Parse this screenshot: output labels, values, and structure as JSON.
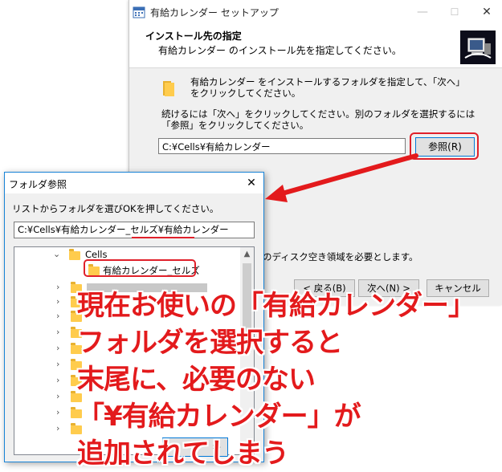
{
  "setup_window": {
    "title": "有給カレンダー セットアップ",
    "header_title": "インストール先の指定",
    "header_subtitle": "有給カレンダー のインストール先を指定してください。",
    "instruction1": "有給カレンダー をインストールするフォルダを指定して、「次へ」をクリックしてください。",
    "instruction2": "続けるには「次へ」をクリックしてください。別のフォルダを選択するには「参照」をクリックしてください。",
    "install_path": "C:¥Cells¥有給カレンダー",
    "browse_button": "参照(R)",
    "disk_space_text": "のディスク空き領域を必要とします。",
    "back_button": "< 戻る(B)",
    "next_button": "次へ(N) >",
    "cancel_button": "キャンセル",
    "minimize_glyph": "—",
    "maximize_glyph": "☐",
    "close_glyph": "✕"
  },
  "browse_dialog": {
    "title": "フォルダ参照",
    "instruction": "リストからフォルダを選びOKを押してください。",
    "path_value": "C:¥Cells¥有給カレンダー_セルズ¥有給カレンダー",
    "tree": {
      "cells_label": "Cells",
      "selected_folder": "有給カレンダー_セルズ"
    },
    "close_glyph": "✕",
    "cancel_fragment": "キ"
  },
  "annotation": {
    "lines": [
      "現在お使いの「有給カレンダー」",
      "フォルダを選択すると",
      "末尾に、必要のない",
      "「¥有給カレンダー」が",
      "追加されてしまう"
    ],
    "color": "#e31a1c"
  },
  "colors": {
    "highlight_red": "#e0202a",
    "accent_blue": "#0078d7",
    "folder_yellow": "#ffcc4d"
  }
}
